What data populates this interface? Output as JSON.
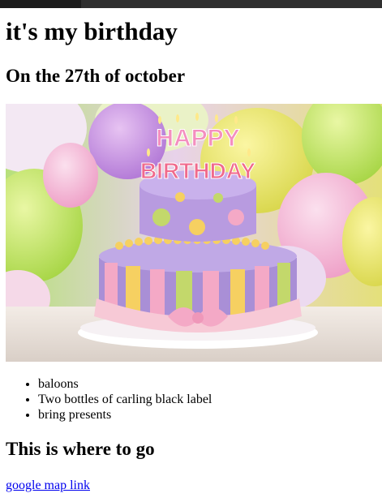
{
  "heading": "it's my birthday",
  "subheading": "On the 27th of october",
  "image": {
    "cake_text_line1": "HAPPY",
    "cake_text_line2": "BIRTHDAY",
    "colors": {
      "cake_purple": "#a98fd6",
      "stripe_pink": "#f4a9c6",
      "stripe_yellow": "#f6d061",
      "stripe_green": "#c3d86b",
      "ribbon_pink": "#f7c9d6"
    }
  },
  "list": {
    "items": [
      "baloons",
      "Two bottles of carling black label",
      "bring presents"
    ]
  },
  "where_heading": "This is where to go",
  "map_link": {
    "label": "google map link"
  }
}
